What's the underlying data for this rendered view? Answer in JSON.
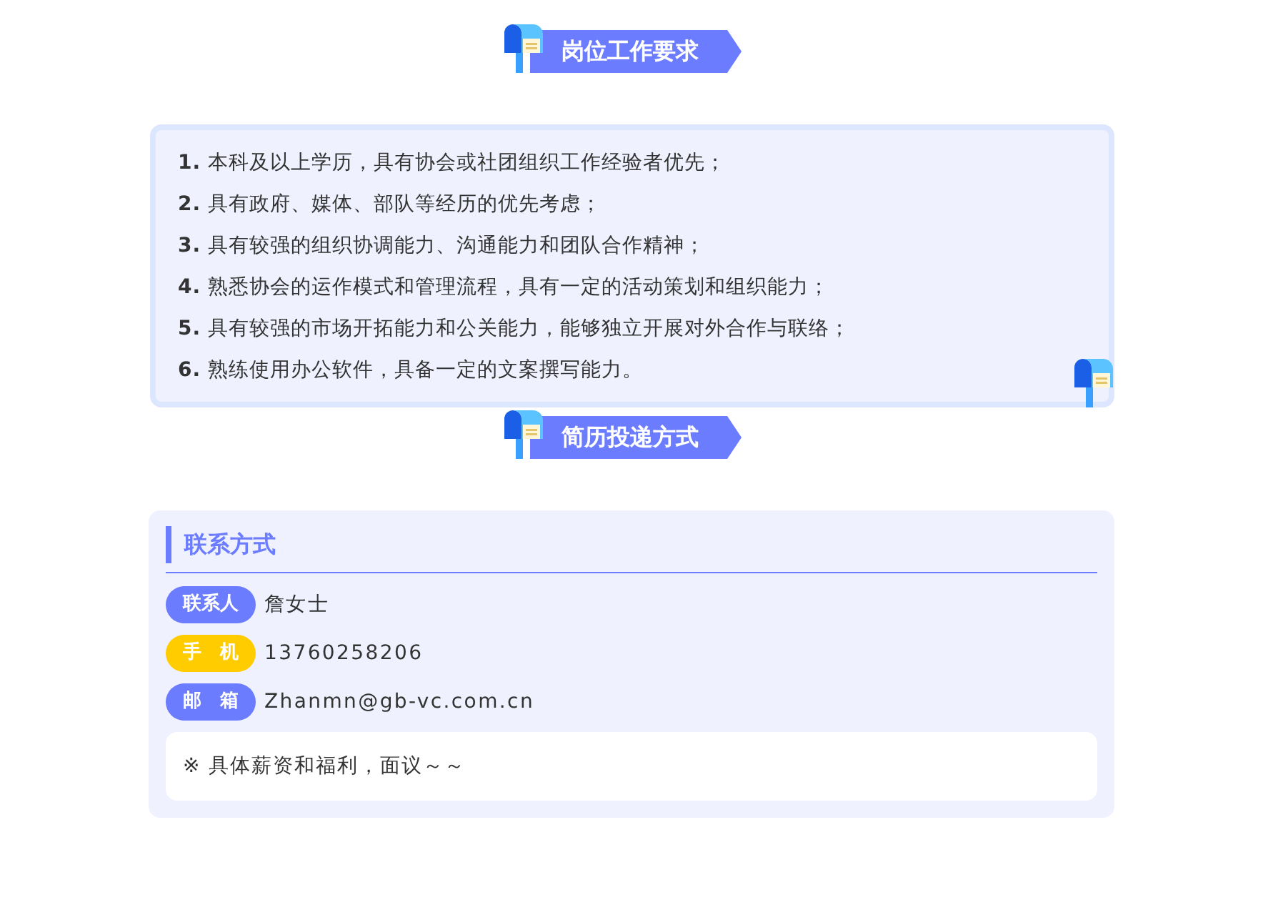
{
  "sections": [
    {
      "title": "岗位工作要求",
      "requirements": [
        "**1.** 本科及以上学历，具有协会或社团组织工作经验者优先；",
        "**2.** 具有政府、媒体、部队等经历的优先考虑；",
        "**3.** 具有较强的组织协调能力、沟通能力和团队合作精神；",
        "**4.** 熟悉协会的运作模式和管理流程，具有一定的活动策划和组织能力；",
        "**5.** 具有较强的市场开拓能力和公关能力，能够独立开展对外合作与联络；",
        "**6.** 熟练使用办公软件，具备一定的文案撰写能力。"
      ]
    },
    {
      "title": "简历投递方式",
      "contact": {
        "heading": "联系方式",
        "items": [
          {
            "label": "联系人",
            "value": "詹女士",
            "color": "#6b7cff"
          },
          {
            "label": "手　机",
            "value": "13760258206",
            "color": "#ffcc00"
          },
          {
            "label": "邮　箱",
            "value": "Zhanmn@gb-vc.com.cn",
            "color": "#6b7cff"
          }
        ],
        "note": "※ 具体薪资和福利，面议～～"
      }
    }
  ]
}
